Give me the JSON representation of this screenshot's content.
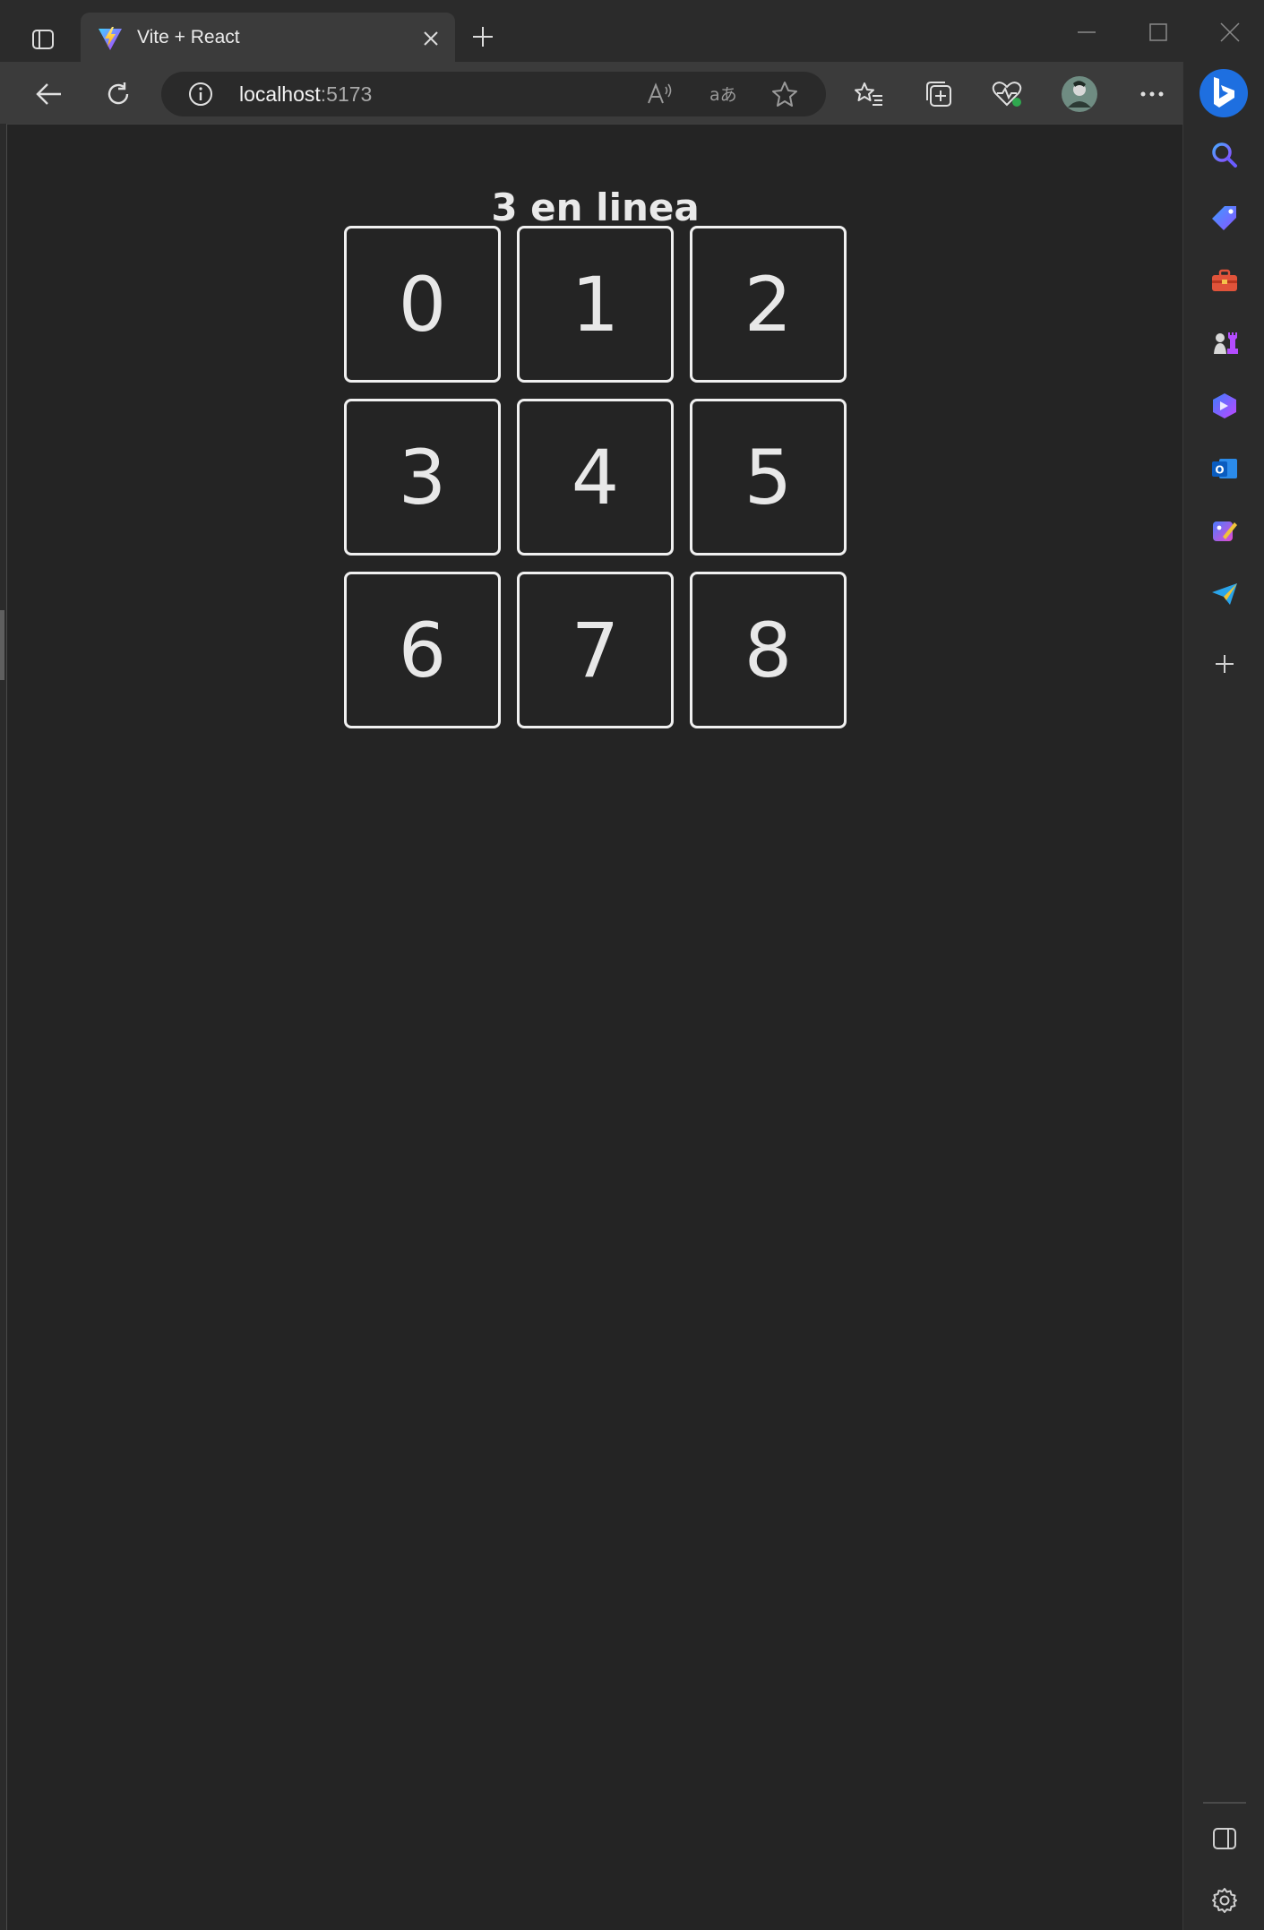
{
  "tab": {
    "title": "Vite + React"
  },
  "address_bar": {
    "host": "localhost",
    "port": ":5173"
  },
  "game": {
    "title": "3 en linea",
    "cells": [
      "0",
      "1",
      "2",
      "3",
      "4",
      "5",
      "6",
      "7",
      "8"
    ]
  },
  "colors": {
    "page_bg": "#242424",
    "chrome_bg": "#2b2b2b",
    "toolbar_bg": "#3b3b3b",
    "cell_border": "#f0f0f0",
    "bing_accent": "#1e6fe0"
  },
  "sidebar": {
    "items": [
      "search-icon",
      "shopping-tag-icon",
      "tools-icon",
      "games-icon",
      "copilot-icon",
      "outlook-icon",
      "designer-icon",
      "send-icon",
      "add-icon"
    ]
  }
}
